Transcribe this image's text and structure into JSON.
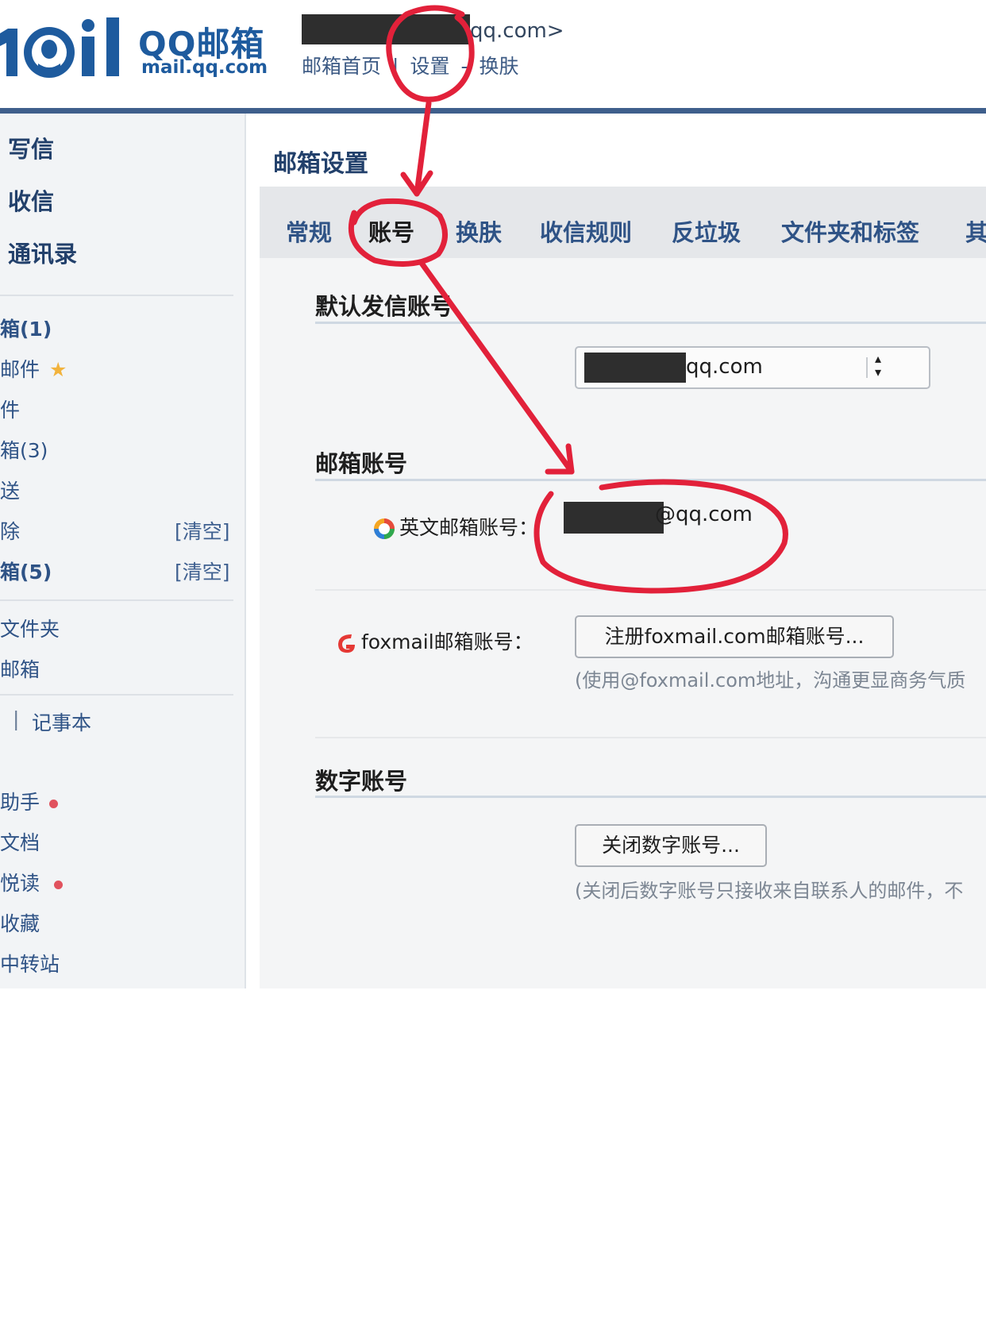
{
  "header": {
    "logo_brand": "QQ邮箱",
    "logo_domain": "mail.qq.com",
    "account_suffix": "qq.com>",
    "nav": [
      "邮箱首页",
      "|",
      "设置",
      "-",
      "换肤"
    ]
  },
  "sidebar": {
    "main_actions": [
      "写信",
      "收信",
      "通讯录"
    ],
    "folders": [
      {
        "label": "箱(1)"
      },
      {
        "label": "邮件"
      },
      {
        "label": "件"
      },
      {
        "label": "箱(3)"
      },
      {
        "label": "送"
      },
      {
        "label": "除",
        "clear": "[清空]"
      },
      {
        "label": "箱(5)",
        "clear": "[清空]"
      }
    ],
    "extra": [
      "文件夹",
      "邮箱"
    ],
    "notepad": [
      "|",
      "记事本"
    ],
    "apps": [
      "助手",
      "文档",
      "悦读",
      "收藏",
      "中转站"
    ]
  },
  "main": {
    "title": "邮箱设置",
    "tabs": [
      "常规",
      "账号",
      "换肤",
      "收信规则",
      "反垃圾",
      "文件夹和标签",
      "其"
    ],
    "active_tab": "账号",
    "default_sender": {
      "title": "默认发信账号",
      "selected_suffix": "qq.com"
    },
    "mailbox_account": {
      "title": "邮箱账号",
      "english_label": "英文邮箱账号：",
      "english_value_suffix": "@qq.com",
      "foxmail_label": "foxmail邮箱账号：",
      "foxmail_button": "注册foxmail.com邮箱账号...",
      "foxmail_hint": "(使用@foxmail.com地址，沟通更显商务气质"
    },
    "numeric_account": {
      "title": "数字账号",
      "close_button": "关闭数字账号...",
      "hint": "(关闭后数字账号只接收来自联系人的邮件，不"
    }
  },
  "colors": {
    "brand_blue": "#1e5b9e",
    "nav_blue": "#2f5386",
    "annotation_red": "#e2213a",
    "header_rule": "#3f5f8c"
  }
}
